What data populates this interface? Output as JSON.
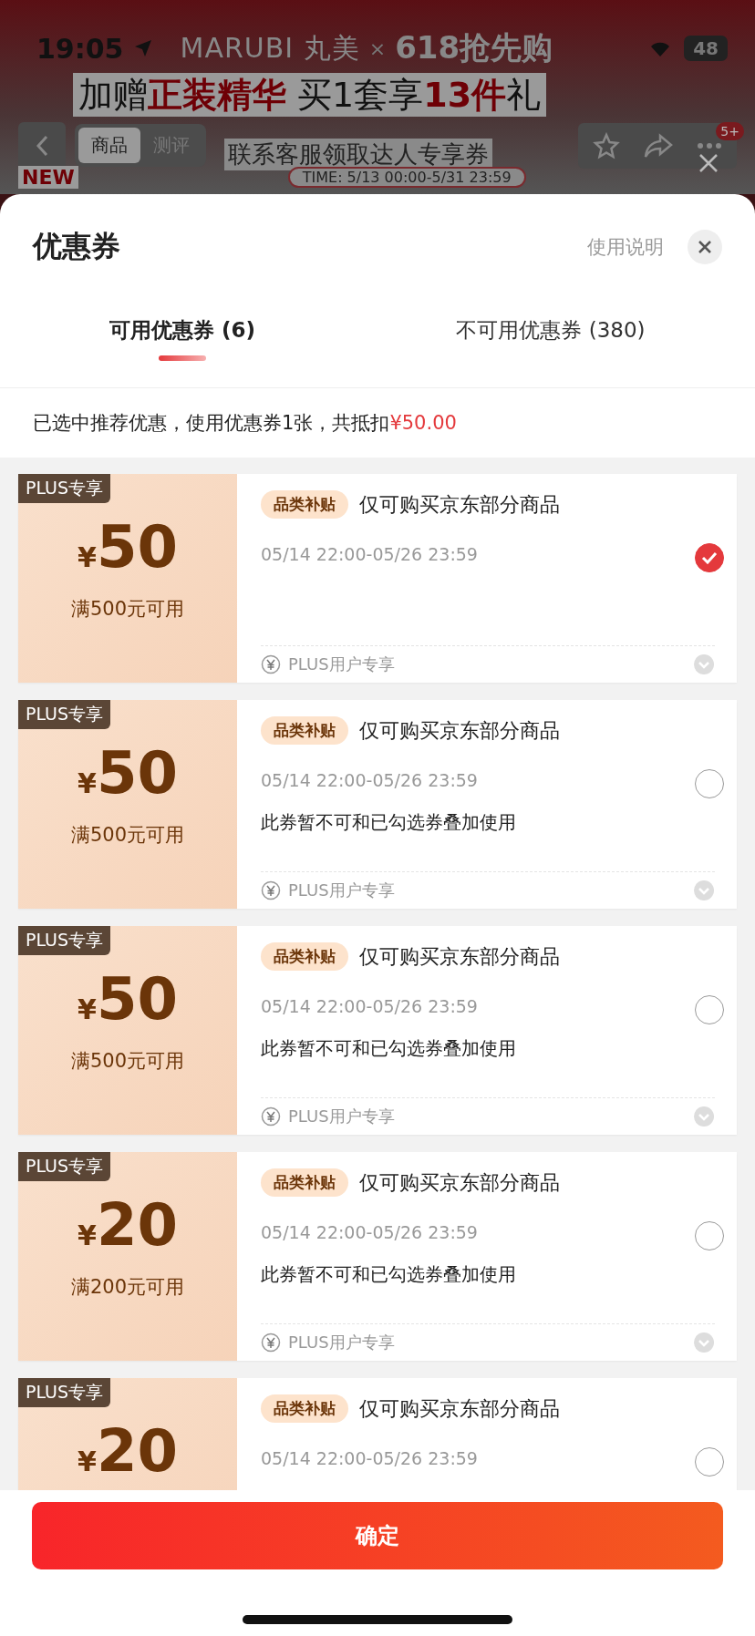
{
  "status_bar": {
    "time": "19:05",
    "battery": "48"
  },
  "background_page": {
    "brand": "MARUBI 丸美",
    "brand_separator": "×",
    "campaign": "618抢先购",
    "headline": [
      {
        "text": "加赠",
        "highlight": false
      },
      {
        "text": "正装精华",
        "highlight": true
      },
      {
        "text": " 买1套享",
        "highlight": false
      },
      {
        "text": "13件",
        "highlight": true
      },
      {
        "text": "礼",
        "highlight": false
      }
    ],
    "tabs": [
      {
        "label": "商品",
        "selected": true
      },
      {
        "label": "测评",
        "selected": false
      }
    ],
    "subheadline": "联系客服领取达人专享券",
    "time_range": "TIME: 5/13 00:00-5/31 23:59",
    "new_tag": "NEW",
    "cart_count": "5+"
  },
  "sheet": {
    "title": "优惠券",
    "help_link": "使用说明",
    "tabs": [
      {
        "label": "可用优惠券 (6)",
        "selected": true
      },
      {
        "label": "不可用优惠券 (380)",
        "selected": false
      }
    ],
    "summary": {
      "text": "已选中推荐优惠，使用优惠券1张，共抵扣",
      "amount": "¥50.00"
    },
    "coupons": [
      {
        "badge": "PLUS专享",
        "currency": "¥",
        "amount": "50",
        "condition": "满500元可用",
        "tag": "品类补贴",
        "title": "仅可购买京东部分商品",
        "validity": "05/14 22:00-05/26 23:59",
        "selected": true,
        "footer": "PLUS用户专享"
      },
      {
        "badge": "PLUS专享",
        "currency": "¥",
        "amount": "50",
        "condition": "满500元可用",
        "tag": "品类补贴",
        "title": "仅可购买京东部分商品",
        "validity": "05/14 22:00-05/26 23:59",
        "note": "此券暂不可和已勾选券叠加使用",
        "selected": false,
        "footer": "PLUS用户专享"
      },
      {
        "badge": "PLUS专享",
        "currency": "¥",
        "amount": "50",
        "condition": "满500元可用",
        "tag": "品类补贴",
        "title": "仅可购买京东部分商品",
        "validity": "05/14 22:00-05/26 23:59",
        "note": "此券暂不可和已勾选券叠加使用",
        "selected": false,
        "footer": "PLUS用户专享"
      },
      {
        "badge": "PLUS专享",
        "currency": "¥",
        "amount": "20",
        "condition": "满200元可用",
        "tag": "品类补贴",
        "title": "仅可购买京东部分商品",
        "validity": "05/14 22:00-05/26 23:59",
        "note": "此券暂不可和已勾选券叠加使用",
        "selected": false,
        "footer": "PLUS用户专享"
      },
      {
        "badge": "PLUS专享",
        "currency": "¥",
        "amount": "20",
        "tag": "品类补贴",
        "title": "仅可购买京东部分商品",
        "validity": "05/14 22:00-05/26 23:59",
        "selected": false
      }
    ],
    "confirm_button": "确定"
  }
}
